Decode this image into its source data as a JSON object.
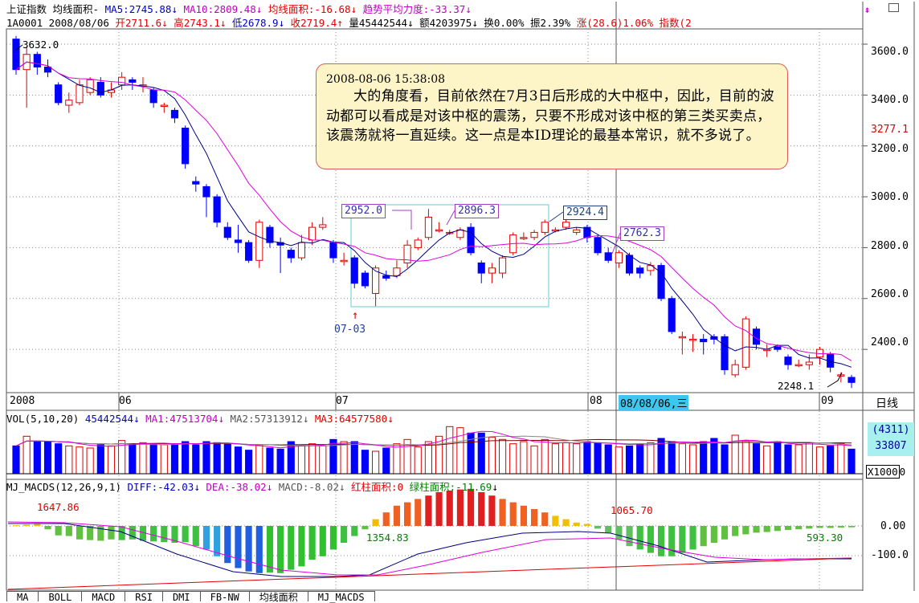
{
  "header": {
    "index_name": "上证指数",
    "indicator_name": "均线面积-",
    "ma5": "MA5:2745.88",
    "ma10": "MA10:2809.48",
    "area": "均线面积:-16.68",
    "trend": "趋势平均力度:-33.37",
    "code_date": "1A0001 2008/08/06",
    "open": "开2711.6",
    "high": "高2743.1",
    "low": "低2678.9",
    "close": "收2719.4",
    "volume": "量45442544",
    "amount": "额4203975",
    "turnover": "换0.00%",
    "amplitude": "振2.39%",
    "change": "涨(28.6)1.06%",
    "index_more": "指数(2",
    "up_arrow": "↑",
    "down_arrow": "↓"
  },
  "note": {
    "timestamp": "2008-08-06 15:38:08",
    "text": "大的角度看，目前依然在7月3日后形成的大中枢中，因此，目前的波动都可以看成是对该中枢的震荡，只要不形成对该中枢的第三类买卖点，该震荡就将一直延续。这一点是本ID理论的最基本常识，就不多说了。"
  },
  "price_axis": {
    "ticks": [
      "3600.0",
      "3400.0",
      "3200.0",
      "3000.0",
      "2800.0",
      "2600.0",
      "2400.0"
    ],
    "current": "3277.1"
  },
  "labels": {
    "high_left": "3632.0",
    "low_right": "2248.1",
    "box1": "2952.0",
    "box2": "2896.3",
    "box3": "2924.4",
    "box4": "2762.3",
    "arrow_date": "07-03"
  },
  "x_axis": {
    "labels": [
      "2008",
      "06",
      "07",
      "08",
      "09"
    ],
    "cursor_date": "08/08/06,三",
    "period": "日线"
  },
  "volume_panel": {
    "title": "VOL(5,10,20)",
    "vol": "45442544",
    "ma1": "MA1:47513704",
    "ma2": "MA2:57313912",
    "ma3": "MA3:64577580",
    "side_top": "(4311)",
    "side_bottom": "33807",
    "unit": "X1000",
    "zero": "0"
  },
  "macd_panel": {
    "title": "MJ_MACDS(12,26,9,1)",
    "diff": "DIFF:-42.03",
    "dea": "DEA:-38.02",
    "macd": "MACD:-8.02",
    "red_area": "红柱面积:0",
    "green_area": "绿柱面积:-11.69",
    "v1": "1647.86",
    "v2": "1354.83",
    "v3": "1065.70",
    "v4": "593.30",
    "axis": [
      "0.00",
      "-100.0"
    ]
  },
  "tabs": [
    "MA",
    "BOLL",
    "MACD",
    "RSI",
    "DMI",
    "FB-NW",
    "均线面积",
    "MJ_MACDS"
  ],
  "colors": {
    "up": "#e00000",
    "down": "#0000ff",
    "ma_blue": "#00008b",
    "ma_mag": "#e000e0",
    "grid": "#555555",
    "box": "#7fd4d4"
  },
  "chart_data": {
    "type": "candlestick",
    "title": "上证指数 均线面积",
    "y_range": [
      2248.1,
      3632.0
    ],
    "candles": [
      {
        "o": 3620,
        "c": 3500,
        "h": 3632,
        "l": 3480
      },
      {
        "o": 3500,
        "c": 3560,
        "h": 3590,
        "l": 3350
      },
      {
        "o": 3560,
        "c": 3510,
        "h": 3570,
        "l": 3480
      },
      {
        "o": 3510,
        "c": 3490,
        "h": 3540,
        "l": 3470
      },
      {
        "o": 3440,
        "c": 3370,
        "h": 3450,
        "l": 3360
      },
      {
        "o": 3360,
        "c": 3380,
        "h": 3410,
        "l": 3330
      },
      {
        "o": 3370,
        "c": 3440,
        "h": 3460,
        "l": 3360
      },
      {
        "o": 3410,
        "c": 3460,
        "h": 3470,
        "l": 3400
      },
      {
        "o": 3450,
        "c": 3400,
        "h": 3470,
        "l": 3390
      },
      {
        "o": 3410,
        "c": 3420,
        "h": 3450,
        "l": 3390
      },
      {
        "o": 3440,
        "c": 3470,
        "h": 3490,
        "l": 3420
      },
      {
        "o": 3460,
        "c": 3450,
        "h": 3470,
        "l": 3420
      },
      {
        "o": 3440,
        "c": 3440,
        "h": 3470,
        "l": 3410
      },
      {
        "o": 3420,
        "c": 3370,
        "h": 3430,
        "l": 3350
      },
      {
        "o": 3360,
        "c": 3360,
        "h": 3370,
        "l": 3330
      },
      {
        "o": 3340,
        "c": 3310,
        "h": 3350,
        "l": 3290
      },
      {
        "o": 3270,
        "c": 3130,
        "h": 3280,
        "l": 3110
      },
      {
        "o": 3060,
        "c": 3050,
        "h": 3080,
        "l": 3020
      },
      {
        "o": 3040,
        "c": 3000,
        "h": 3050,
        "l": 2920
      },
      {
        "o": 3000,
        "c": 2900,
        "h": 3010,
        "l": 2880
      },
      {
        "o": 2880,
        "c": 2840,
        "h": 2900,
        "l": 2830
      },
      {
        "o": 2830,
        "c": 2820,
        "h": 2890,
        "l": 2780
      },
      {
        "o": 2820,
        "c": 2750,
        "h": 2830,
        "l": 2740
      },
      {
        "o": 2750,
        "c": 2900,
        "h": 2910,
        "l": 2720
      },
      {
        "o": 2880,
        "c": 2820,
        "h": 2890,
        "l": 2800
      },
      {
        "o": 2820,
        "c": 2810,
        "h": 2840,
        "l": 2700
      },
      {
        "o": 2790,
        "c": 2760,
        "h": 2800,
        "l": 2740
      },
      {
        "o": 2760,
        "c": 2820,
        "h": 2850,
        "l": 2750
      },
      {
        "o": 2830,
        "c": 2880,
        "h": 2900,
        "l": 2810
      },
      {
        "o": 2880,
        "c": 2890,
        "h": 2920,
        "l": 2870
      },
      {
        "o": 2820,
        "c": 2760,
        "h": 2830,
        "l": 2740
      },
      {
        "o": 2750,
        "c": 2750,
        "h": 2780,
        "l": 2730
      },
      {
        "o": 2760,
        "c": 2660,
        "h": 2770,
        "l": 2640
      },
      {
        "o": 2700,
        "c": 2650,
        "h": 2710,
        "l": 2640
      },
      {
        "o": 2620,
        "c": 2720,
        "h": 2730,
        "l": 2570
      },
      {
        "o": 2690,
        "c": 2680,
        "h": 2710,
        "l": 2670
      },
      {
        "o": 2690,
        "c": 2720,
        "h": 2750,
        "l": 2680
      },
      {
        "o": 2740,
        "c": 2810,
        "h": 2830,
        "l": 2720
      },
      {
        "o": 2800,
        "c": 2830,
        "h": 2840,
        "l": 2790
      },
      {
        "o": 2840,
        "c": 2920,
        "h": 2952,
        "l": 2830
      },
      {
        "o": 2870,
        "c": 2870,
        "h": 2900,
        "l": 2860
      },
      {
        "o": 2860,
        "c": 2860,
        "h": 2870,
        "l": 2850
      },
      {
        "o": 2840,
        "c": 2870,
        "h": 2880,
        "l": 2830
      },
      {
        "o": 2880,
        "c": 2780,
        "h": 2896,
        "l": 2770
      },
      {
        "o": 2740,
        "c": 2700,
        "h": 2750,
        "l": 2660
      },
      {
        "o": 2700,
        "c": 2720,
        "h": 2740,
        "l": 2660
      },
      {
        "o": 2700,
        "c": 2760,
        "h": 2770,
        "l": 2680
      },
      {
        "o": 2780,
        "c": 2850,
        "h": 2860,
        "l": 2770
      },
      {
        "o": 2840,
        "c": 2840,
        "h": 2860,
        "l": 2830
      },
      {
        "o": 2840,
        "c": 2860,
        "h": 2870,
        "l": 2830
      },
      {
        "o": 2860,
        "c": 2900,
        "h": 2910,
        "l": 2850
      },
      {
        "o": 2870,
        "c": 2870,
        "h": 2880,
        "l": 2860
      },
      {
        "o": 2880,
        "c": 2900,
        "h": 2924,
        "l": 2870
      },
      {
        "o": 2860,
        "c": 2870,
        "h": 2880,
        "l": 2850
      },
      {
        "o": 2880,
        "c": 2840,
        "h": 2890,
        "l": 2820
      },
      {
        "o": 2840,
        "c": 2780,
        "h": 2850,
        "l": 2770
      },
      {
        "o": 2780,
        "c": 2750,
        "h": 2800,
        "l": 2740
      },
      {
        "o": 2740,
        "c": 2780,
        "h": 2790,
        "l": 2720
      },
      {
        "o": 2770,
        "c": 2700,
        "h": 2780,
        "l": 2690
      },
      {
        "o": 2720,
        "c": 2700,
        "h": 2730,
        "l": 2680
      },
      {
        "o": 2710,
        "c": 2730,
        "h": 2743,
        "l": 2690
      },
      {
        "o": 2730,
        "c": 2600,
        "h": 2740,
        "l": 2590
      },
      {
        "o": 2600,
        "c": 2470,
        "h": 2610,
        "l": 2460
      },
      {
        "o": 2450,
        "c": 2450,
        "h": 2470,
        "l": 2380
      },
      {
        "o": 2440,
        "c": 2440,
        "h": 2460,
        "l": 2390
      },
      {
        "o": 2440,
        "c": 2430,
        "h": 2460,
        "l": 2380
      },
      {
        "o": 2450,
        "c": 2440,
        "h": 2460,
        "l": 2420
      },
      {
        "o": 2450,
        "c": 2320,
        "h": 2460,
        "l": 2300
      },
      {
        "o": 2300,
        "c": 2340,
        "h": 2360,
        "l": 2290
      },
      {
        "o": 2330,
        "c": 2520,
        "h": 2530,
        "l": 2320
      },
      {
        "o": 2480,
        "c": 2420,
        "h": 2490,
        "l": 2400
      },
      {
        "o": 2400,
        "c": 2400,
        "h": 2420,
        "l": 2370
      },
      {
        "o": 2410,
        "c": 2400,
        "h": 2420,
        "l": 2390
      },
      {
        "o": 2370,
        "c": 2340,
        "h": 2380,
        "l": 2320
      },
      {
        "o": 2340,
        "c": 2340,
        "h": 2360,
        "l": 2330
      },
      {
        "o": 2340,
        "c": 2350,
        "h": 2380,
        "l": 2320
      },
      {
        "o": 2370,
        "c": 2400,
        "h": 2410,
        "l": 2340
      },
      {
        "o": 2380,
        "c": 2330,
        "h": 2390,
        "l": 2310
      },
      {
        "o": 2300,
        "c": 2300,
        "h": 2310,
        "l": 2270
      },
      {
        "o": 2290,
        "c": 2270,
        "h": 2300,
        "l": 2248
      }
    ],
    "volume": [
      520,
      700,
      610,
      600,
      560,
      520,
      500,
      480,
      540,
      520,
      620,
      560,
      580,
      560,
      540,
      560,
      600,
      540,
      600,
      580,
      560,
      500,
      440,
      540,
      480,
      460,
      600,
      520,
      560,
      520,
      640,
      600,
      600,
      440,
      420,
      480,
      560,
      640,
      500,
      600,
      700,
      880,
      860,
      760,
      760,
      680,
      640,
      560,
      600,
      520,
      640,
      560,
      580,
      560,
      600,
      580,
      540,
      500,
      520,
      560,
      580,
      660,
      600,
      560,
      540,
      600,
      660,
      540,
      720,
      620,
      560,
      520,
      600,
      540,
      540,
      580,
      500,
      520,
      560,
      460
    ],
    "macd_hist": [
      2,
      4,
      6,
      -10,
      -28,
      -30,
      -40,
      -42,
      -44,
      -40,
      -42,
      -40,
      -44,
      -46,
      -48,
      -50,
      -48,
      -60,
      -70,
      -90,
      -110,
      -125,
      -135,
      -140,
      -138,
      -140,
      -130,
      -120,
      -100,
      -90,
      -70,
      -50,
      -30,
      -10,
      20,
      40,
      60,
      70,
      80,
      90,
      100,
      105,
      108,
      110,
      100,
      90,
      80,
      70,
      60,
      50,
      40,
      30,
      20,
      10,
      6,
      -8,
      -20,
      -40,
      -60,
      -70,
      -80,
      -90,
      -90,
      -80,
      -70,
      -60,
      -50,
      -40,
      -30,
      -25,
      -20,
      -18,
      -15,
      -12,
      -10,
      -8,
      -6,
      -6,
      -5,
      -4
    ],
    "series": [
      {
        "name": "MA5",
        "color": "#00008b"
      },
      {
        "name": "MA10",
        "color": "#e000e0"
      }
    ]
  }
}
